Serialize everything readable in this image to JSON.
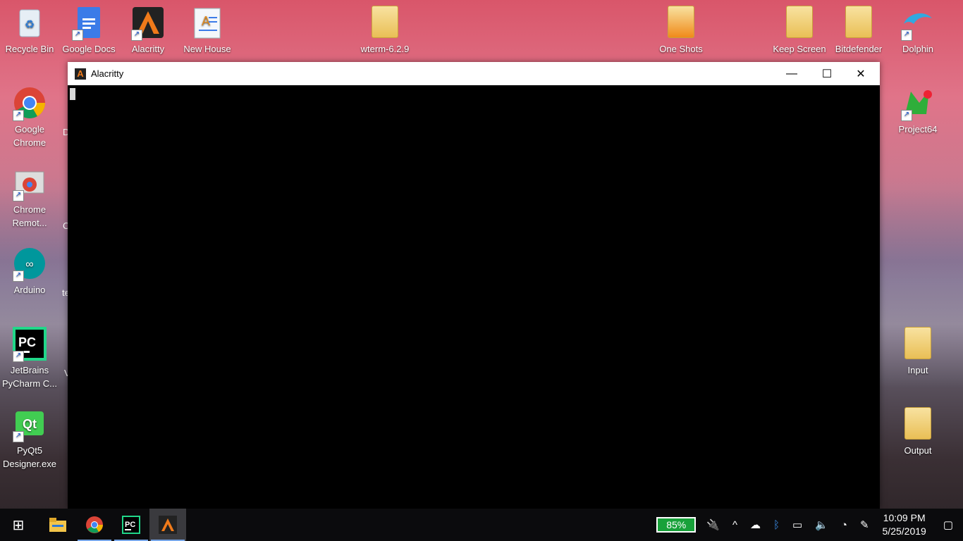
{
  "desktop": {
    "icons": [
      {
        "label": "Recycle Bin"
      },
      {
        "label": "Google Docs"
      },
      {
        "label": "Alacritty"
      },
      {
        "label": "New House"
      },
      {
        "label": "wterm-6.2.9"
      },
      {
        "label": "One Shots"
      },
      {
        "label": "Keep Screen"
      },
      {
        "label": "Bitdefender"
      },
      {
        "label": "Dolphin"
      },
      {
        "label": "Google Chrome"
      },
      {
        "label": "Chrome Remot..."
      },
      {
        "label": "Arduino"
      },
      {
        "label": "JetBrains PyCharm C..."
      },
      {
        "label": "PyQt5 Designer.exe"
      },
      {
        "label": "Project64"
      },
      {
        "label": "Input"
      },
      {
        "label": "Output"
      }
    ],
    "partial_labels": [
      "D",
      "C",
      "te",
      "V"
    ]
  },
  "window": {
    "title": "Alacritty",
    "minimize_glyph": "—",
    "maximize_glyph": "☐",
    "close_glyph": "✕"
  },
  "taskbar": {
    "apps": [
      {
        "icon": "windows-start-icon",
        "glyph": "⊞"
      },
      {
        "icon": "file-explorer-icon",
        "glyph": "📁"
      },
      {
        "icon": "chrome-icon",
        "glyph": "◉"
      },
      {
        "icon": "pycharm-icon",
        "glyph": "PC"
      },
      {
        "icon": "alacritty-icon",
        "glyph": "A"
      }
    ],
    "battery_percent": "85%",
    "tray_icons": [
      "plug-icon",
      "chevron-up-icon",
      "cloud-upload-icon",
      "bluetooth-icon",
      "battery-saver-icon",
      "volume-icon",
      "wifi-icon",
      "pen-icon"
    ],
    "time": "10:09 PM",
    "date": "5/25/2019"
  },
  "colors": {
    "battery": "#18a13a",
    "accent": "#77a6e8"
  }
}
